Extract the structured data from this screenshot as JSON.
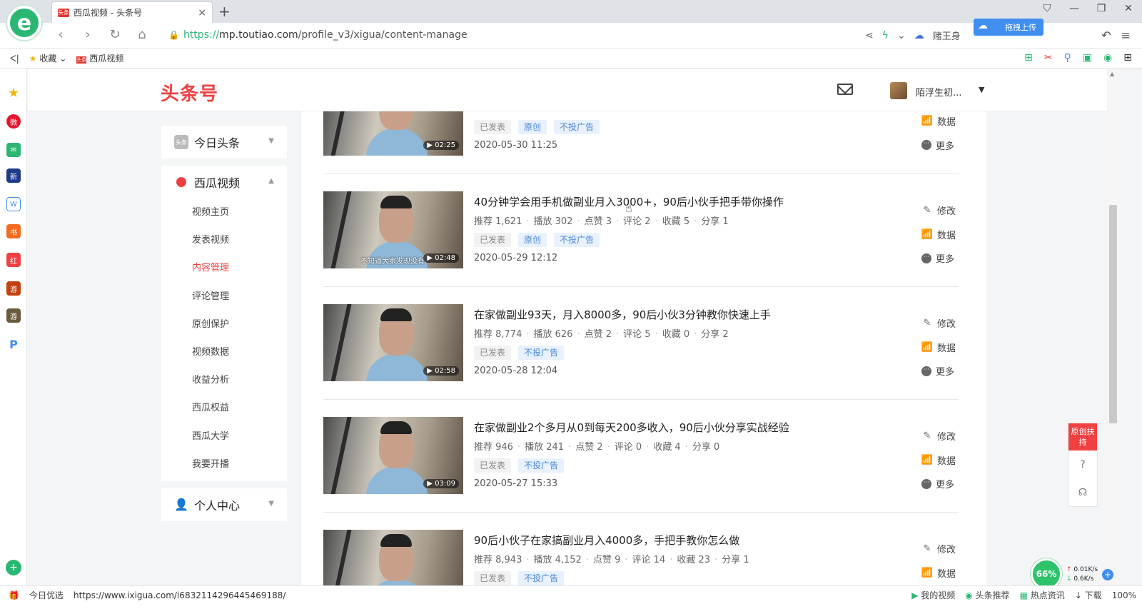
{
  "browser": {
    "tab_title": "西瓜视频 - 头条号",
    "tab_favicon": "头条",
    "new_tab": "+",
    "close": "×",
    "url_scheme": "https://",
    "url_host": "mp.toutiao.com",
    "url_path": "/profile_v3/xigua/content-manage",
    "profile_label": "赌王身",
    "upload_label": "拖拽上传",
    "bookmarks_toggle": "ᐸ|",
    "bookmarks": [
      {
        "label": "收藏"
      },
      {
        "label": "西瓜视频"
      }
    ],
    "status_url": "https://www.ixigua.com/i6832114296445469188/",
    "status_left_label": "今日优选",
    "status_right": [
      "我的视频",
      "头条推荐",
      "热点资讯",
      "下载",
      "100%"
    ],
    "speed_percent": "66%",
    "speed_up": "0.01K/s",
    "speed_down": "0.6K/s"
  },
  "header": {
    "brand": "头条号",
    "user_name": "陌浮生初...",
    "user_caret": "▼"
  },
  "sidebar": {
    "toutiao": {
      "label": "今日头条",
      "icon": "头条"
    },
    "xigua": {
      "label": "西瓜视频",
      "items": [
        "视频主页",
        "发表视频",
        "内容管理",
        "评论管理",
        "原创保护",
        "视频数据",
        "收益分析",
        "西瓜权益",
        "西瓜大学",
        "我要开播"
      ],
      "active_index": 2
    },
    "personal": {
      "label": "个人中心"
    }
  },
  "videos": [
    {
      "title": "",
      "stats": [],
      "tags": [
        {
          "label": "已发表",
          "style": "gray"
        },
        {
          "label": "原创",
          "style": "blue"
        },
        {
          "label": "不投广告",
          "style": "blue"
        }
      ],
      "date": "2020-05-30 11:25",
      "duration": "02:25",
      "subtitle": "",
      "actions": [
        "数据",
        "更多"
      ]
    },
    {
      "title": "40分钟学会用手机做副业月入3000+，90后小伙手把手带你操作",
      "stats": [
        "推荐 1,621",
        "播放 302",
        "点赞 3",
        "评论 2",
        "收藏 5",
        "分享 1"
      ],
      "tags": [
        {
          "label": "已发表",
          "style": "gray"
        },
        {
          "label": "原创",
          "style": "blue"
        },
        {
          "label": "不投广告",
          "style": "blue"
        }
      ],
      "date": "2020-05-29 12:12",
      "duration": "02:48",
      "subtitle": "不知道大家发现没有",
      "actions": [
        "修改",
        "数据",
        "更多"
      ]
    },
    {
      "title": "在家做副业93天，月入8000多，90后小伙3分钟教你快速上手",
      "stats": [
        "推荐 8,774",
        "播放 626",
        "点赞 2",
        "评论 5",
        "收藏 0",
        "分享 2"
      ],
      "tags": [
        {
          "label": "已发表",
          "style": "gray"
        },
        {
          "label": "不投广告",
          "style": "blue"
        }
      ],
      "date": "2020-05-28 12:04",
      "duration": "02:58",
      "subtitle": "",
      "actions": [
        "修改",
        "数据",
        "更多"
      ]
    },
    {
      "title": "在家做副业2个多月从0到每天200多收入，90后小伙分享实战经验",
      "stats": [
        "推荐 946",
        "播放 241",
        "点赞 2",
        "评论 0",
        "收藏 4",
        "分享 0"
      ],
      "tags": [
        {
          "label": "已发表",
          "style": "gray"
        },
        {
          "label": "不投广告",
          "style": "blue"
        }
      ],
      "date": "2020-05-27 15:33",
      "duration": "03:09",
      "subtitle": "",
      "actions": [
        "修改",
        "数据",
        "更多"
      ]
    },
    {
      "title": "90后小伙子在家搞副业月入4000多，手把手教你怎么做",
      "stats": [
        "推荐 8,943",
        "播放 4,152",
        "点赞 9",
        "评论 14",
        "收藏 23",
        "分享 1"
      ],
      "tags": [
        {
          "label": "已发表",
          "style": "gray"
        },
        {
          "label": "不投广告",
          "style": "blue"
        }
      ],
      "date": "",
      "duration": "",
      "subtitle": "",
      "actions": [
        "修改",
        "数据"
      ]
    }
  ],
  "float_panel": {
    "original_support": "原创扶持"
  },
  "icons": {
    "edit": "pencil-icon",
    "data": "bar-chart-icon",
    "more": "ellipsis-icon"
  },
  "colors": {
    "brand_red": "#f04142",
    "tag_blue": "#4a86d6",
    "browser_green": "#2bb673"
  }
}
